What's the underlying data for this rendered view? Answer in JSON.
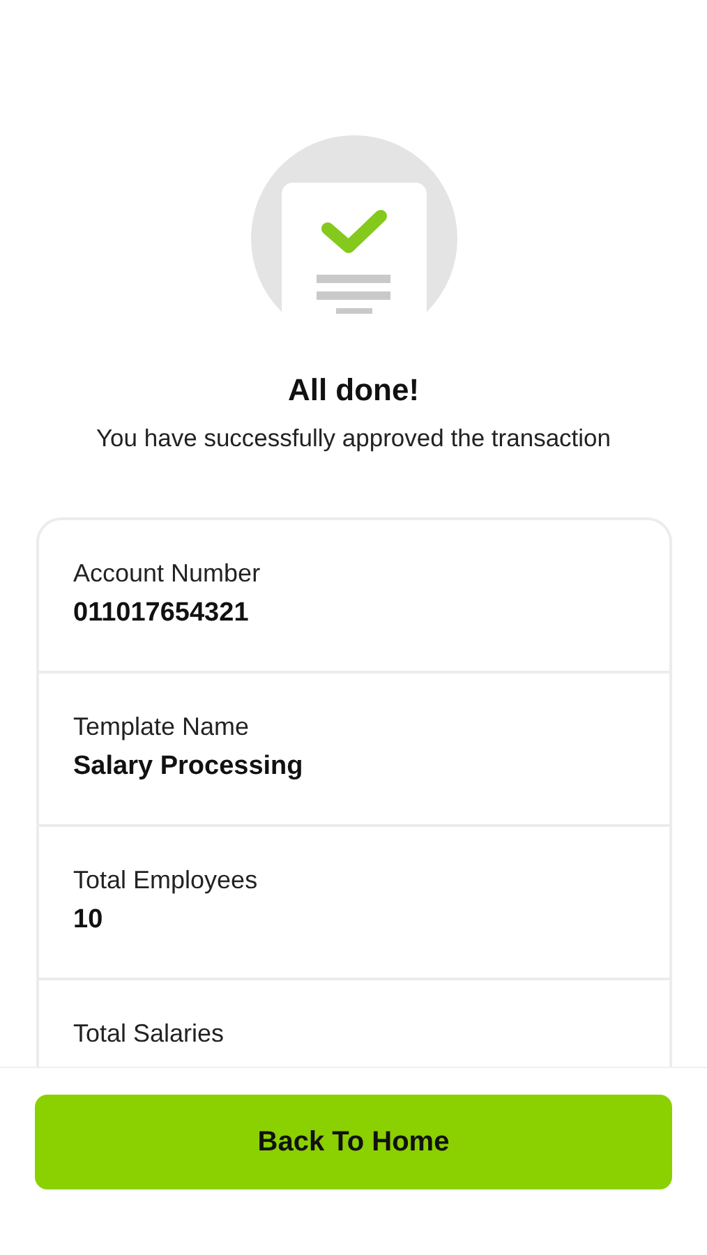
{
  "title": "All done!",
  "message": "You have successfully approved the transaction",
  "details": [
    {
      "label": "Account Number",
      "value": "011017654321"
    },
    {
      "label": "Template Name",
      "value": "Salary Processing"
    },
    {
      "label": "Total Employees",
      "value": "10"
    },
    {
      "label": "Total Salaries"
    }
  ],
  "button": "Back To Home"
}
